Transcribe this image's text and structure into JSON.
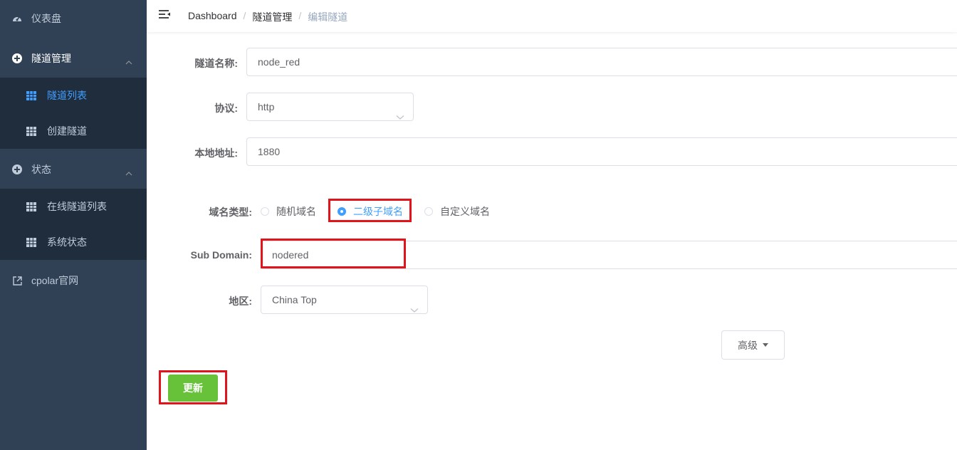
{
  "sidebar": {
    "items": [
      {
        "label": "仪表盘",
        "icon": "dashboard-icon"
      },
      {
        "label": "隧道管理",
        "icon": "tunnel-management-icon"
      },
      {
        "label": "隧道列表",
        "icon": "grid-icon",
        "active": true
      },
      {
        "label": "创建隧道",
        "icon": "grid-icon"
      },
      {
        "label": "状态",
        "icon": "status-icon"
      },
      {
        "label": "在线隧道列表",
        "icon": "grid-icon"
      },
      {
        "label": "系统状态",
        "icon": "grid-icon"
      },
      {
        "label": "cpolar官网",
        "icon": "external-link-icon"
      }
    ]
  },
  "header": {
    "breadcrumb": [
      "Dashboard",
      "隧道管理",
      "编辑隧道"
    ]
  },
  "form": {
    "tunnel_name": {
      "label": "隧道名称:",
      "value": "node_red"
    },
    "protocol": {
      "label": "协议:",
      "value": "http"
    },
    "local_address": {
      "label": "本地地址:",
      "value": "1880"
    },
    "domain_type": {
      "label": "域名类型:",
      "options": [
        "随机域名",
        "二级子域名",
        "自定义域名"
      ],
      "selected": 1
    },
    "sub_domain": {
      "label": "Sub Domain:",
      "value": "nodered"
    },
    "region": {
      "label": "地区:",
      "value": "China Top"
    },
    "advanced_label": "高级",
    "update_label": "更新"
  },
  "colors": {
    "sidebar_bg": "#304156",
    "submenu_bg": "#1f2d3d",
    "active": "#409eff",
    "success": "#67c23a",
    "highlight": "#e0141a"
  }
}
